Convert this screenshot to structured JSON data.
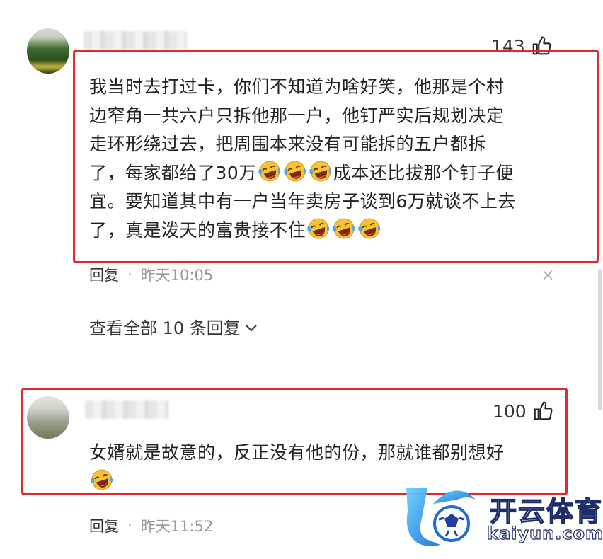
{
  "comment1": {
    "likes": "143",
    "text_lines": [
      "我当时去打过卡，你们不知道为啥好笑，他那是个村",
      "边窄角一共六户只拆他那一户，他钉严实后规划决定",
      "走环形绕过去，把周围本来没有可能拆的五户都拆",
      "了，每家都给了30万",
      "成本还比拔那个钉子便",
      "宜。要知道其中有一户当年卖房子谈到6万就谈不上去",
      "了，真是泼天的富贵接不住"
    ],
    "reply_label": "回复",
    "dot": "·",
    "time": "昨天10:05"
  },
  "view_all_replies": "查看全部 10 条回复",
  "comment2": {
    "likes": "100",
    "text": "女婿就是故意的，反正没有他的份，那就谁都别想好",
    "reply_label": "回复",
    "dot": "·",
    "time": "昨天11:52"
  },
  "watermark": {
    "brand": "开云体育",
    "domain": "kaiyun.com"
  },
  "colors": {
    "highlight_frame": "#e5262c",
    "emoji_face": "#f7c234",
    "tear": "#4aa8e8"
  }
}
